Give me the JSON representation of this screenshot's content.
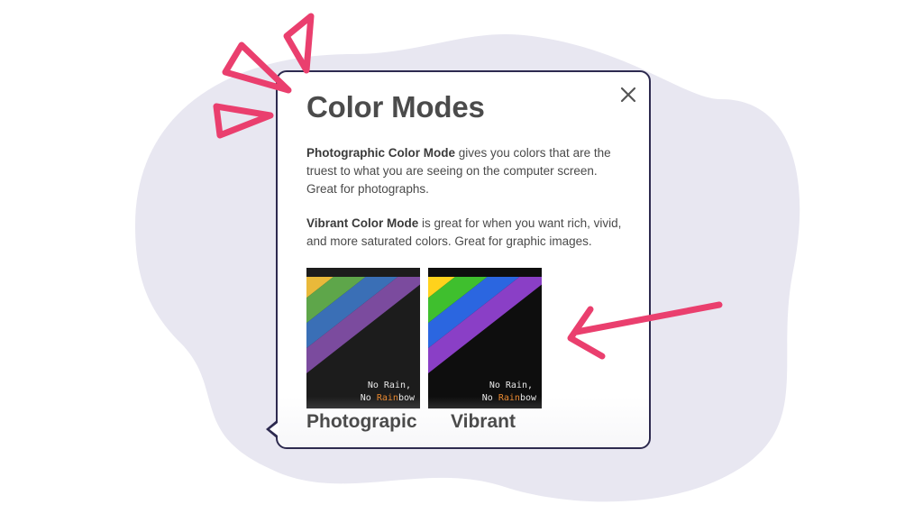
{
  "popover": {
    "title": "Color Modes",
    "close_icon": "close-icon",
    "photographic": {
      "bold": "Photographic Color Mode",
      "text": " gives you colors that are the truest to what you are seeing on the computer screen. Great for photographs."
    },
    "vibrant": {
      "bold": "Vibrant Color Mode",
      "text": " is great for when you want rich, vivid, and more saturated colors.  Great for graphic images."
    },
    "thumbnails": [
      {
        "label": "Photograpic",
        "caption_line1": "No Rain,",
        "caption_line2_pre": "No ",
        "caption_line2_highlight": "Rain",
        "caption_line2_post": "bow"
      },
      {
        "label": "Vibrant",
        "caption_line1": "No Rain,",
        "caption_line2_pre": "No ",
        "caption_line2_highlight": "Rain",
        "caption_line2_post": "bow"
      }
    ]
  },
  "colors": {
    "accent_pink": "#ea3f6e",
    "blob": "#e8e7f1",
    "border": "#2d2a4f"
  }
}
